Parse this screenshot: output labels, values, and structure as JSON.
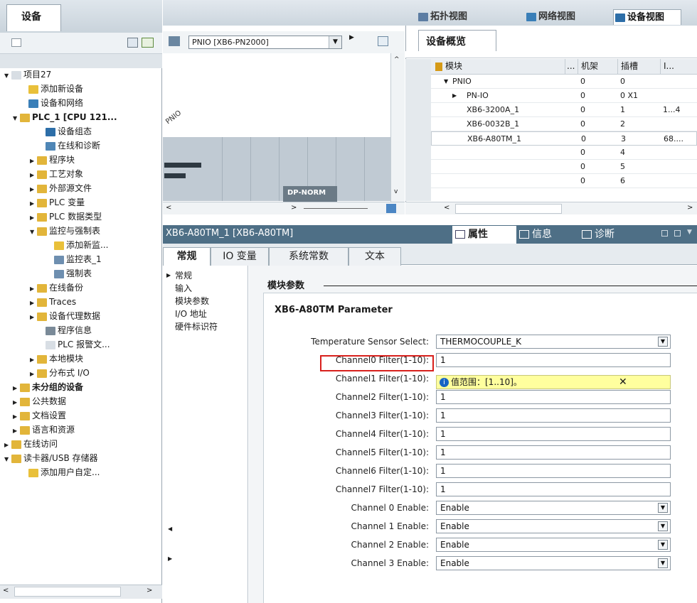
{
  "left_panel": {
    "tab_label": "设备",
    "tree": [
      {
        "label": "项目27",
        "indent": 0,
        "arrow": "▼",
        "icon": "doc"
      },
      {
        "label": "添加新设备",
        "indent": 2,
        "arrow": "",
        "icon": "add"
      },
      {
        "label": "设备和网络",
        "indent": 2,
        "arrow": "",
        "icon": "net"
      },
      {
        "label": "PLC_1 [CPU 121...",
        "indent": 1,
        "arrow": "▼",
        "icon": "plc",
        "bold": true
      },
      {
        "label": "设备组态",
        "indent": 4,
        "arrow": "",
        "icon": "cfg"
      },
      {
        "label": "在线和诊断",
        "indent": 4,
        "arrow": "",
        "icon": "diag"
      },
      {
        "label": "程序块",
        "indent": 3,
        "arrow": "▶",
        "icon": "folder"
      },
      {
        "label": "工艺对象",
        "indent": 3,
        "arrow": "▶",
        "icon": "folder"
      },
      {
        "label": "外部源文件",
        "indent": 3,
        "arrow": "▶",
        "icon": "folder"
      },
      {
        "label": "PLC 变量",
        "indent": 3,
        "arrow": "▶",
        "icon": "folder"
      },
      {
        "label": "PLC 数据类型",
        "indent": 3,
        "arrow": "▶",
        "icon": "folder"
      },
      {
        "label": "监控与强制表",
        "indent": 3,
        "arrow": "▼",
        "icon": "folder"
      },
      {
        "label": "添加新监...",
        "indent": 5,
        "arrow": "",
        "icon": "add"
      },
      {
        "label": "监控表_1",
        "indent": 5,
        "arrow": "",
        "icon": "table"
      },
      {
        "label": "强制表",
        "indent": 5,
        "arrow": "",
        "icon": "table"
      },
      {
        "label": "在线备份",
        "indent": 3,
        "arrow": "▶",
        "icon": "folder"
      },
      {
        "label": "Traces",
        "indent": 3,
        "arrow": "▶",
        "icon": "folder"
      },
      {
        "label": "设备代理数据",
        "indent": 3,
        "arrow": "▶",
        "icon": "folder"
      },
      {
        "label": "程序信息",
        "indent": 4,
        "arrow": "",
        "icon": "info"
      },
      {
        "label": "PLC 报警文...",
        "indent": 4,
        "arrow": "",
        "icon": "doc"
      },
      {
        "label": "本地模块",
        "indent": 3,
        "arrow": "▶",
        "icon": "folder"
      },
      {
        "label": "分布式 I/O",
        "indent": 3,
        "arrow": "▶",
        "icon": "folder"
      },
      {
        "label": "未分组的设备",
        "indent": 1,
        "arrow": "▶",
        "icon": "folder",
        "bold": true
      },
      {
        "label": "公共数据",
        "indent": 1,
        "arrow": "▶",
        "icon": "folder"
      },
      {
        "label": "文档设置",
        "indent": 1,
        "arrow": "▶",
        "icon": "folder"
      },
      {
        "label": "语言和资源",
        "indent": 1,
        "arrow": "▶",
        "icon": "folder"
      },
      {
        "label": "在线访问",
        "indent": 0,
        "arrow": "▶",
        "icon": "folder"
      },
      {
        "label": "读卡器/USB 存储器",
        "indent": 0,
        "arrow": "▼",
        "icon": "folder"
      },
      {
        "label": "添加用户自定...",
        "indent": 2,
        "arrow": "",
        "icon": "add"
      }
    ]
  },
  "view_tabs": {
    "topology": "拓扑视图",
    "network": "网络视图",
    "device": "设备视图"
  },
  "device_combo": "PNIO [XB6-PN2000]",
  "graphic": {
    "rotated_label": "PNIO",
    "module_label": "DP-NORM"
  },
  "overview": {
    "tab_label": "设备概览",
    "columns": {
      "module": "模块",
      "more": "...",
      "rack": "机架",
      "slot": "插槽",
      "io": "I..."
    },
    "rows": [
      {
        "arrow": "▼",
        "name": "PNIO",
        "rack": "0",
        "slot": "0",
        "io": "",
        "indent": 0
      },
      {
        "arrow": "▶",
        "name": "PN-IO",
        "rack": "0",
        "slot": "0 X1",
        "io": "",
        "indent": 1
      },
      {
        "arrow": "",
        "name": "XB6-3200A_1",
        "rack": "0",
        "slot": "1",
        "io": "1...4",
        "indent": 1
      },
      {
        "arrow": "",
        "name": "XB6-0032B_1",
        "rack": "0",
        "slot": "2",
        "io": "",
        "indent": 1
      },
      {
        "arrow": "",
        "name": "XB6-A80TM_1",
        "rack": "0",
        "slot": "3",
        "io": "68....",
        "indent": 1
      },
      {
        "arrow": "",
        "name": "",
        "rack": "0",
        "slot": "4",
        "io": "",
        "indent": 1
      },
      {
        "arrow": "",
        "name": "",
        "rack": "0",
        "slot": "5",
        "io": "",
        "indent": 1
      },
      {
        "arrow": "",
        "name": "",
        "rack": "0",
        "slot": "6",
        "io": "",
        "indent": 1
      }
    ]
  },
  "properties": {
    "title": "XB6-A80TM_1 [XB6-A80TM]",
    "tabs": {
      "props": "属性",
      "info": "信息",
      "diag": "诊断"
    },
    "subtabs": {
      "general": "常规",
      "io_vars": "IO 变量",
      "sys_const": "系统常数",
      "text": "文本"
    },
    "nav": [
      "常规",
      "输入",
      "模块参数",
      "I/O 地址",
      "硬件标识符"
    ],
    "nav_arrow": "▶",
    "section_title": "模块参数",
    "param_title": "XB6-A80TM Parameter",
    "tooltip": {
      "text": "值范围：[1..10]。",
      "close": "✕"
    },
    "params": [
      {
        "label": "Temperature Sensor Select:",
        "value": "THERMOCOUPLE_K",
        "dropdown": true
      },
      {
        "label": "Channel0 Filter(1-10):",
        "value": "1",
        "dropdown": false
      },
      {
        "label": "Channel1 Filter(1-10):",
        "value": "",
        "dropdown": false
      },
      {
        "label": "Channel2 Filter(1-10):",
        "value": "1",
        "dropdown": false
      },
      {
        "label": "Channel3 Filter(1-10):",
        "value": "1",
        "dropdown": false
      },
      {
        "label": "Channel4 Filter(1-10):",
        "value": "1",
        "dropdown": false
      },
      {
        "label": "Channel5 Filter(1-10):",
        "value": "1",
        "dropdown": false
      },
      {
        "label": "Channel6 Filter(1-10):",
        "value": "1",
        "dropdown": false
      },
      {
        "label": "Channel7 Filter(1-10):",
        "value": "1",
        "dropdown": false
      },
      {
        "label": "Channel 0 Enable:",
        "value": "Enable",
        "dropdown": true
      },
      {
        "label": "Channel 1 Enable:",
        "value": "Enable",
        "dropdown": true
      },
      {
        "label": "Channel 2 Enable:",
        "value": "Enable",
        "dropdown": true
      },
      {
        "label": "Channel 3 Enable:",
        "value": "Enable",
        "dropdown": true
      }
    ]
  },
  "colors": {
    "accent": "#4e6f86",
    "highlight": "#d8201c",
    "tooltip_bg": "#ffff9e",
    "folder": "#e2b53a",
    "info": "#1763c4"
  }
}
